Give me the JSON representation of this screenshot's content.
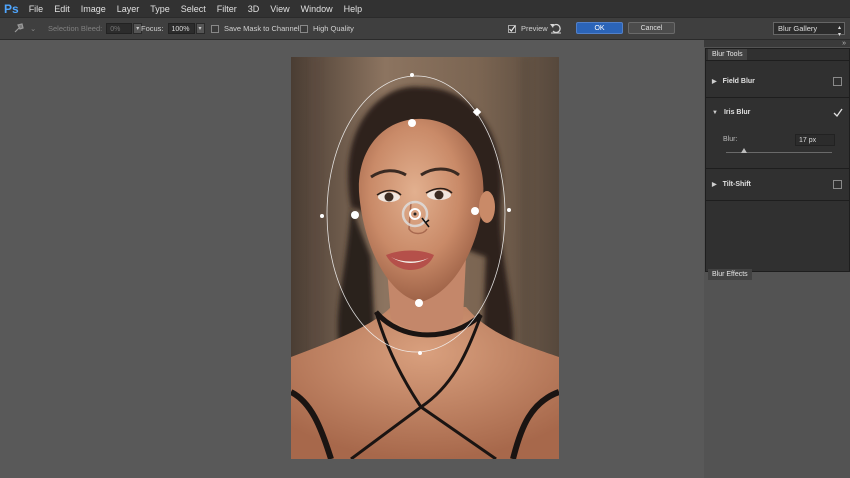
{
  "app": {
    "logo": "Ps"
  },
  "menu": [
    "File",
    "Edit",
    "Image",
    "Layer",
    "Type",
    "Select",
    "Filter",
    "3D",
    "View",
    "Window",
    "Help"
  ],
  "options": {
    "pin_icon": "pin-icon",
    "selection_bleed_label": "Selection Bleed:",
    "selection_bleed_value": "0%",
    "focus_label": "Focus:",
    "focus_value": "100%",
    "save_mask_label": "Save Mask to Channels",
    "high_quality_label": "High Quality",
    "preview_label": "Preview",
    "preview_checked": true,
    "ok_label": "OK",
    "cancel_label": "Cancel",
    "gallery_value": "Blur Gallery"
  },
  "blur_tools": {
    "tab_label": "Blur Tools",
    "field_blur": {
      "label": "Field Blur",
      "enabled": false
    },
    "iris_blur": {
      "label": "Iris Blur",
      "enabled": true,
      "blur_label": "Blur:",
      "blur_value": "17 px",
      "slider_fraction": 0.17
    },
    "tilt_shift": {
      "label": "Tilt-Shift",
      "enabled": false
    }
  },
  "blur_effects": {
    "tab_label": "Blur Effects"
  },
  "colors": {
    "accent": "#2b64b8",
    "ui_bg": "#595959",
    "menubar": "#323232"
  }
}
